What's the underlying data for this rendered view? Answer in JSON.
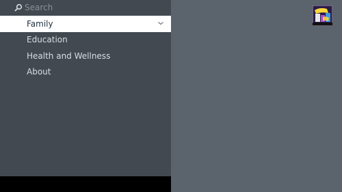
{
  "search": {
    "label": "Search",
    "icon": "search-icon"
  },
  "menu": {
    "items": [
      {
        "label": "Family",
        "selected": true
      },
      {
        "label": "Education",
        "selected": false
      },
      {
        "label": "Health and Wellness",
        "selected": false
      },
      {
        "label": "About",
        "selected": false
      }
    ]
  },
  "thumbnail": {
    "icon": "app-thumbnail-icon"
  },
  "colors": {
    "sidebar": "#424950",
    "content": "#5b636d",
    "selected_bg": "#ffffff",
    "text": "#d8dde2",
    "selected_text": "#232f3e",
    "search_text": "#8a9199"
  }
}
